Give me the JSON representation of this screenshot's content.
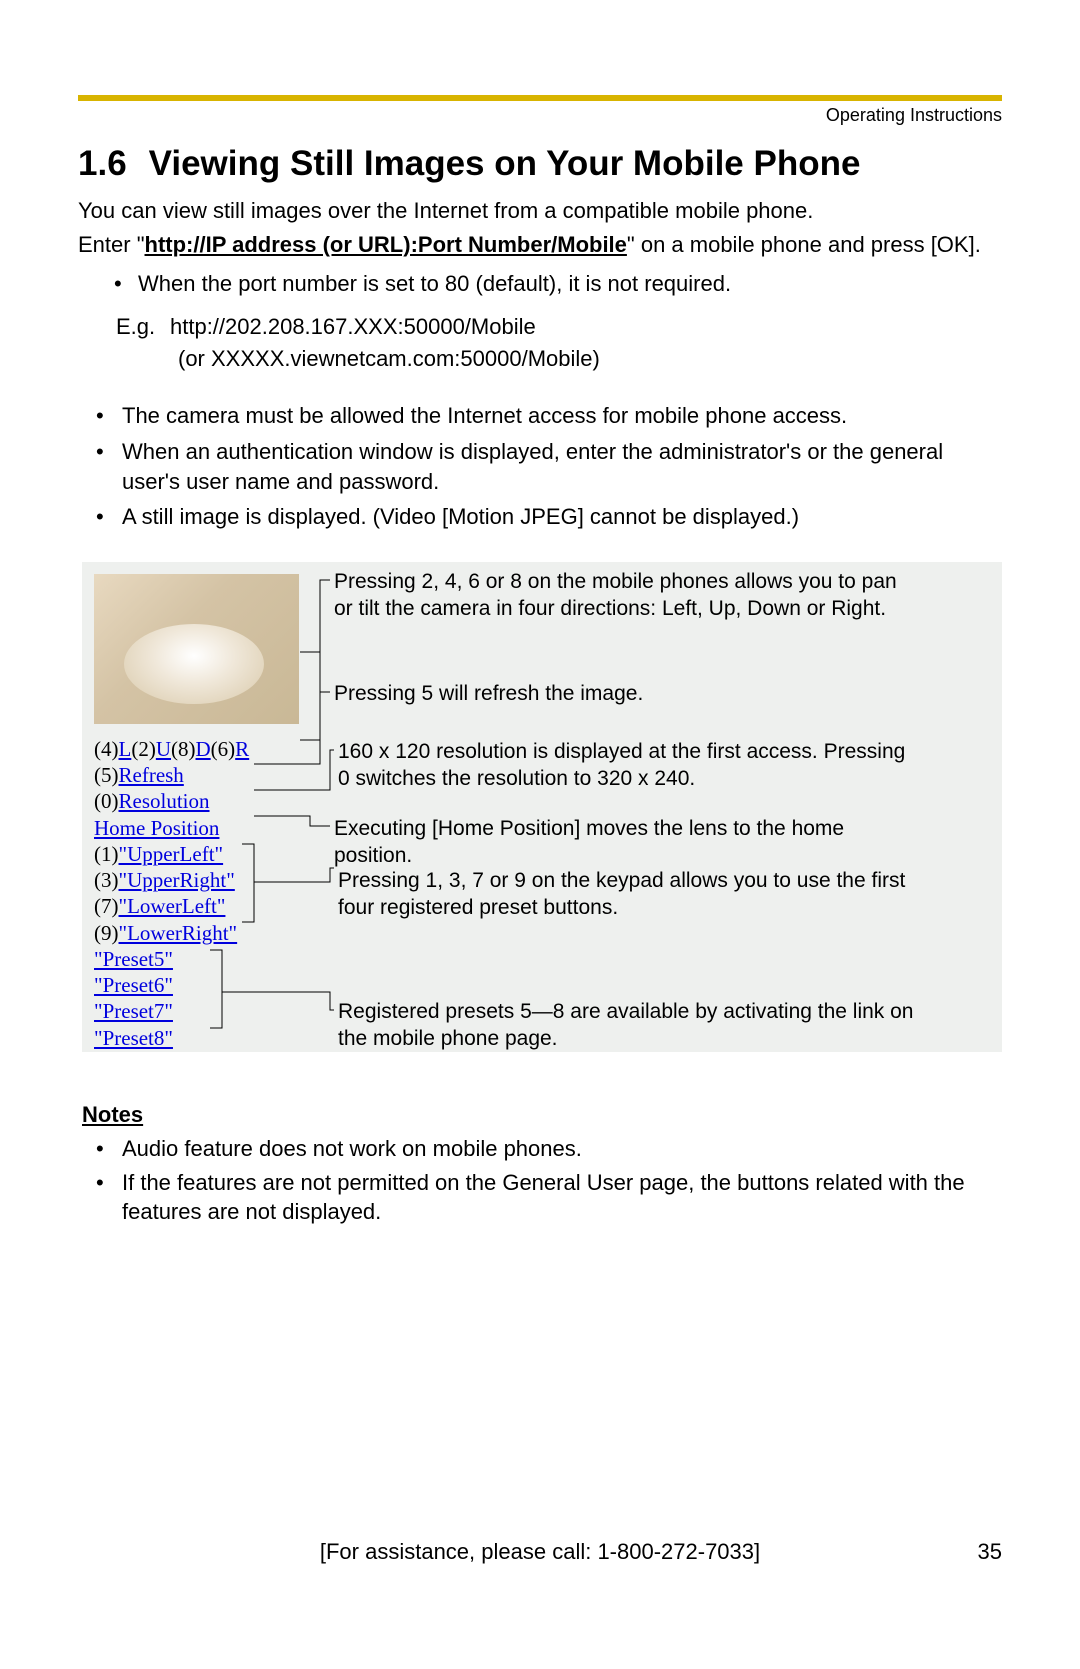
{
  "header": {
    "top_label": "Operating Instructions"
  },
  "section": {
    "number": "1.6",
    "title": "Viewing Still Images on Your Mobile Phone"
  },
  "intro": {
    "line1": "You can view still images over the Internet from a compatible mobile phone.",
    "enter_prefix": "Enter \"",
    "url": "http://IP address (or URL):Port Number/Mobile",
    "enter_suffix": "\" on a mobile phone and press [OK]."
  },
  "sub_bullet": "When the port number is set to 80 (default), it is not required.",
  "example": {
    "label": "E.g.",
    "line1": "http://202.208.167.XXX:50000/Mobile",
    "line2": "(or XXXXX.viewnetcam.com:50000/Mobile)"
  },
  "bullets": [
    "The camera must be allowed the Internet access for mobile phone access.",
    "When an authentication window is displayed, enter the administrator's or the general user's user name and password.",
    "A still image is displayed. (Video [Motion JPEG] cannot be displayed.)"
  ],
  "phone_menu": {
    "nav_row": {
      "p4": "(4)",
      "L": "L",
      "p2": "(2)",
      "U": "U",
      "p8": "(8)",
      "D": "D",
      "p6": "(6)",
      "R": "R"
    },
    "refresh": {
      "prefix": "(5)",
      "label": "Refresh"
    },
    "resolution": {
      "prefix": "(0)",
      "label": "Resolution"
    },
    "home": {
      "label": "Home Position"
    },
    "presets_num": [
      {
        "prefix": "(1)",
        "label": "\"UpperLeft\""
      },
      {
        "prefix": "(3)",
        "label": "\"UpperRight\""
      },
      {
        "prefix": "(7)",
        "label": "\"LowerLeft\""
      },
      {
        "prefix": "(9)",
        "label": "\"LowerRight\""
      }
    ],
    "presets_extra": [
      "\"Preset5\"",
      "\"Preset6\"",
      "\"Preset7\"",
      "\"Preset8\""
    ]
  },
  "callouts": {
    "c1": "Pressing 2, 4, 6 or 8 on the mobile phones allows you to pan or tilt the camera in four directions: Left, Up, Down or Right.",
    "c2": "Pressing 5 will refresh the image.",
    "c3": "160 x 120 resolution is displayed at the first access. Pressing 0 switches the resolution to 320 x 240.",
    "c4": "Executing [Home Position] moves the lens to the home position.",
    "c5": "Pressing 1, 3, 7 or 9 on the keypad allows you to use the first four registered preset buttons.",
    "c6": "Registered presets 5—8 are available by activating the link on the mobile phone page."
  },
  "notes": {
    "heading": "Notes",
    "items": [
      "Audio feature does not work on mobile phones.",
      "If the features are not permitted on the General User page, the buttons related with the features are not displayed."
    ]
  },
  "footer": {
    "text": "[For assistance, please call: 1-800-272-7033]",
    "page": "35"
  }
}
